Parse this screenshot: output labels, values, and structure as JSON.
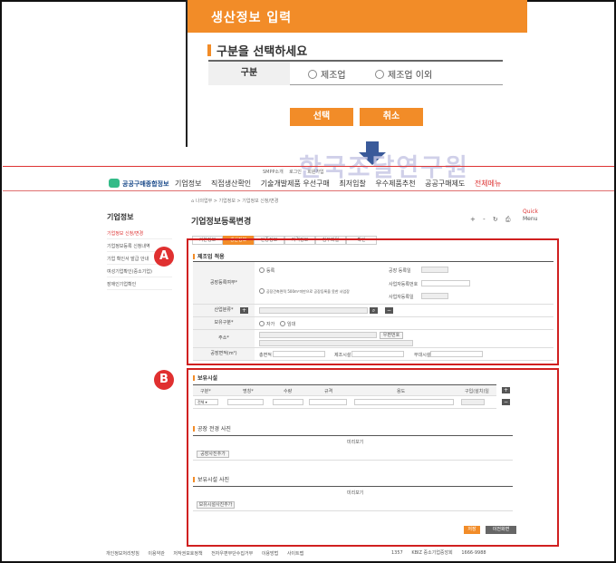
{
  "dialog": {
    "title": "생산정보 입력",
    "section": "구분을 선택하세요",
    "label": "구분",
    "options": [
      "제조업",
      "제조업 이외"
    ],
    "confirm": "선택",
    "cancel": "취소"
  },
  "watermark": "한국조달연구원",
  "header": {
    "util_links": [
      "SMPP소개",
      "로그인",
      "회원가입"
    ],
    "logo": "공공구매종합정보",
    "nav": [
      "기업정보",
      "직접생산확인",
      "기술개발제품 우선구매",
      "최저입찰",
      "우수제품추천",
      "공공구매제도",
      "전체메뉴"
    ]
  },
  "lnb": {
    "title": "기업정보",
    "items": [
      "기업정보 신청/변경",
      "기업정보등록 신청내역",
      "기업 확인서 발급 안내",
      "여성기업확인(중소기업)",
      "장애인기업확인"
    ]
  },
  "content": {
    "breadcrumb": "⌂ 나의업무 > 기업정보 > 기업정보 신청/변경",
    "title": "기업정보등록변경",
    "tools": "+ - ↻ ⎙",
    "quick": "Quick",
    "quick2": "Menu",
    "tabs": [
      "기본정보",
      "생산정보",
      "인증정보",
      "자격정보",
      "첨부파일",
      "확인"
    ]
  },
  "section_a": {
    "badge": "A",
    "title": "제조업 적용",
    "rows": [
      {
        "label": "공장등록여부*",
        "opt1": "등록",
        "opt2": "공장건축면적 500m²미만으로 공장등록을 못한 사업장"
      },
      {
        "label": "산업분류*"
      },
      {
        "label": "보유구분*",
        "opt1": "자가",
        "opt2": "임대"
      },
      {
        "label": "주소*",
        "btn": "우편번호"
      },
      {
        "label": "공장면적(m²)",
        "f1": "총면적",
        "f2": "제조시설",
        "f3": "부대시설"
      }
    ],
    "right_labels": [
      "공장 등록일",
      "사업자등록번호",
      "사업자등록일"
    ]
  },
  "section_b": {
    "badge": "B",
    "title": "보유시설",
    "cols": [
      "구분*",
      "명칭*",
      "수량",
      "규격",
      "용도",
      "구입(설치)일"
    ],
    "select": "전체",
    "photo1_title": "공장 전경 사진",
    "photo1_head": "미리보기",
    "photo1_btn": "공장사진추가",
    "photo2_title": "보유시설 사진",
    "photo2_head": "미리보기",
    "photo2_btn": "보유시설사진추가",
    "save": "저장",
    "prev": "이전화면"
  },
  "footer": {
    "links": [
      "개인정보처리방침",
      "이용약관",
      "저작권보호정책",
      "전자우편무단수집거부",
      "이용방법",
      "사이트맵"
    ],
    "right": [
      "1357",
      "KBIZ 중소기업중앙회",
      "1666-9988"
    ]
  }
}
